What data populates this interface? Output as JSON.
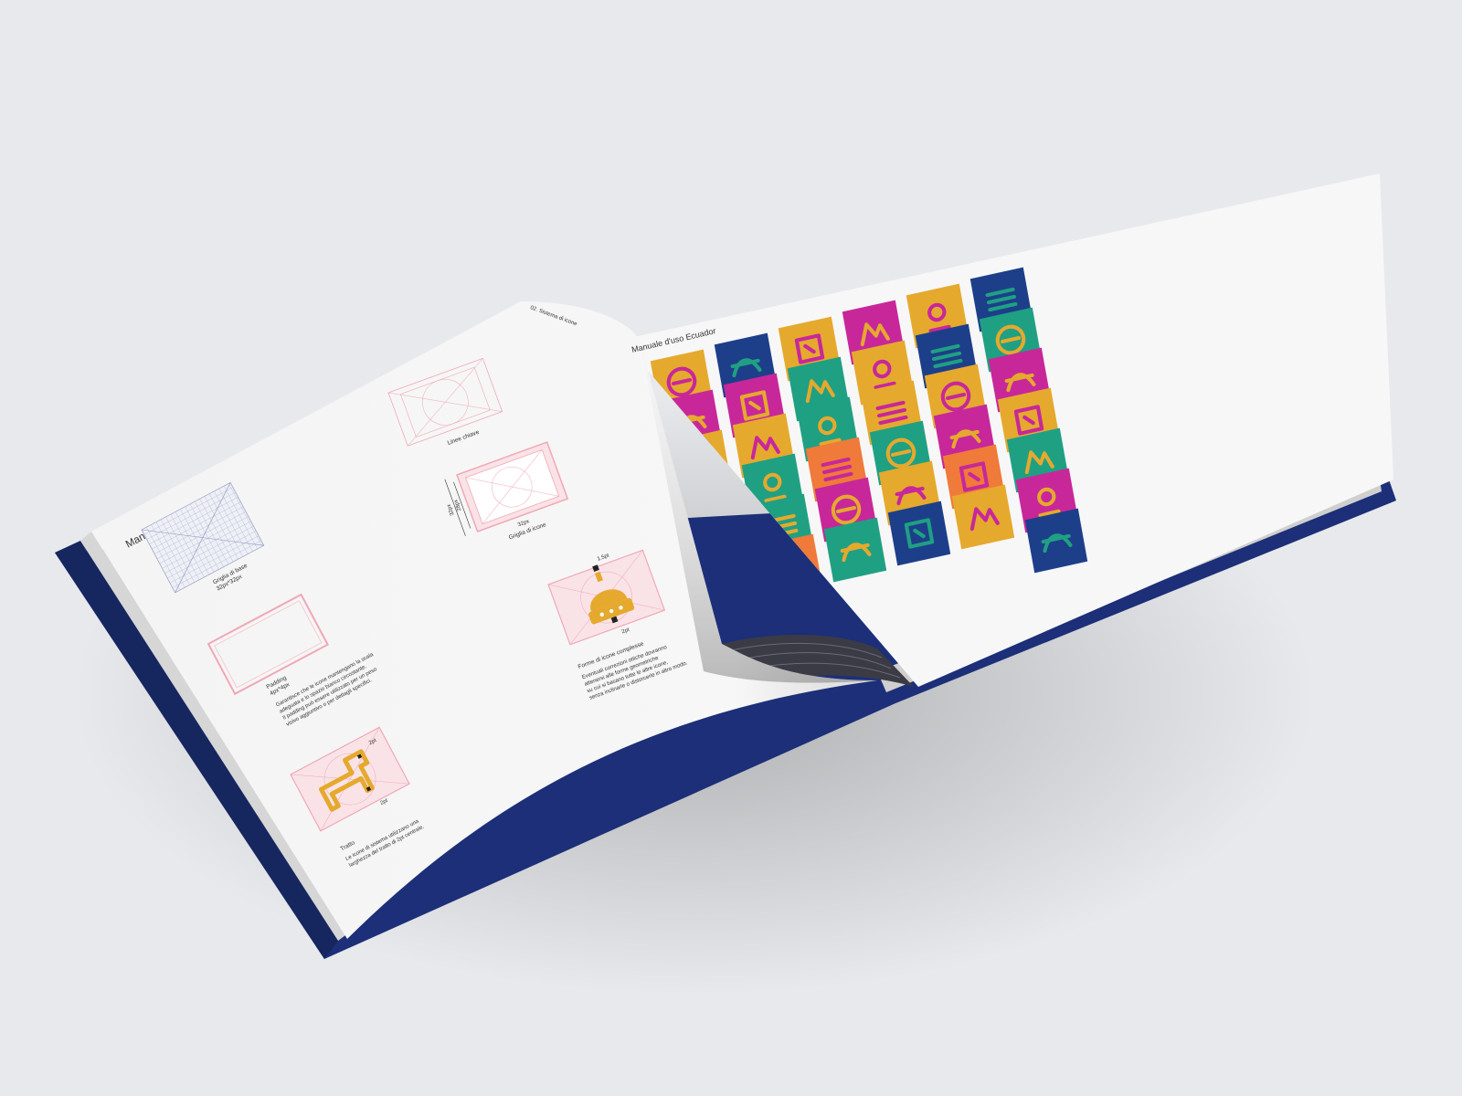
{
  "left_page": {
    "header": "02. Sistema di icone",
    "title": "Manuale d'uso Ecuador",
    "grid_base_label": "Griglia di base",
    "grid_base_size": "32px*32px",
    "linee_chiave_label": "Linee chiave",
    "griglia_icone_label": "Griglia di icone",
    "dim_32px_a": "32px",
    "dim_32px_b": "32px",
    "dim_28px": "28px",
    "padding_label": "Padding",
    "padding_size": "4px*4px",
    "padding_text_lines": [
      "Garantisce che le icone mantengano la scala",
      "adeguata e lo spazio bianco circostante.",
      "Il padding può essere utilizzato per un peso",
      "visivo aggiuntivo o per dettagli specifici."
    ],
    "stroke_2pt_a": "2pt",
    "stroke_2pt_b": "2pt",
    "tratto_label": "Tratto",
    "tratto_text_lines": [
      "Le icone di sistema utilizzano una",
      "larghezza del tratto di 2pt centrale."
    ],
    "stroke_15pt": "1.5pt",
    "stroke_2pt_c": "2pt",
    "forme_label": "Forme di icone complesse",
    "forme_text_lines": [
      "Eventuali correzioni ottiche dovranno",
      "attenersi alle forme geometriche",
      "su cui si basano tutte le altre icone,",
      "senza inclinarle o distorcerle in altro modo."
    ]
  },
  "right_page": {
    "header": "02. Sistema di icone",
    "title": "Manuale d'uso Ecuador"
  },
  "colors": {
    "background": "#e8e9ec",
    "cover": "#1c2f78",
    "page": "#f7f7f7",
    "yellow": "#e5a92e",
    "magenta": "#c8279a",
    "teal": "#1fa083",
    "navy": "#1d3f8a",
    "orange": "#ef7a3a",
    "grid_pink": "#f2b7c0"
  },
  "icon_grid": [
    [
      "yellow-hat-icon",
      "navy-waterfall-icon",
      "yellow-flower-icon",
      "magenta-fence-icon",
      "yellow-music-icon",
      "navy-turtle-icon"
    ],
    [
      "magenta-mountain-icon",
      "magenta-plant-icon",
      "teal-hiker-icon",
      "yellow-bird-icon",
      "navy-cocktail-icon",
      "teal-condor-icon"
    ],
    [
      "yellow-llama-icon",
      "yellow-sun-icon",
      "teal-banana-icon",
      "yellow-fruit-icon",
      "yellow-tulip-icon",
      "magenta-statue-icon"
    ],
    [
      "magenta-church-icon",
      "teal-sunrise-icon",
      "orange-shell-icon",
      "teal-cyclist-icon",
      "magenta-compass-icon",
      "yellow-mask-icon"
    ],
    [
      "yellow-face-icon",
      "teal-tower-icon",
      "magenta-dome-icon",
      "yellow-bird-icon",
      "orange-stairs-icon",
      "teal-cacao-icon"
    ],
    [
      "navy-leaf-icon",
      "orange-layers-icon",
      "teal-bike-icon",
      "navy-banana-icon",
      "yellow-dancer-icon",
      "magenta-castle-icon"
    ],
    [
      "magenta-building-icon",
      "",
      "",
      "",
      "",
      "navy-iguana-icon"
    ]
  ]
}
